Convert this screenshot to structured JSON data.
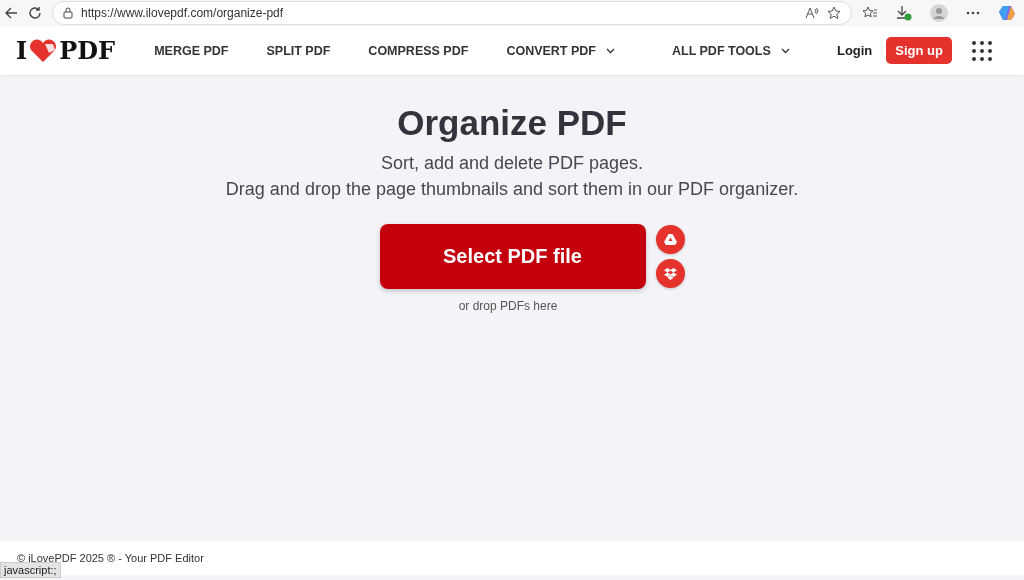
{
  "browser": {
    "url": "https://www.ilovepdf.com/organize-pdf",
    "status_tooltip": "javascript:;"
  },
  "header": {
    "logo_left": "I",
    "logo_right": "PDF",
    "nav": [
      {
        "label": "MERGE PDF",
        "dropdown": false
      },
      {
        "label": "SPLIT PDF",
        "dropdown": false
      },
      {
        "label": "COMPRESS PDF",
        "dropdown": false
      },
      {
        "label": "CONVERT PDF",
        "dropdown": true
      },
      {
        "label": "ALL PDF TOOLS",
        "dropdown": true
      }
    ],
    "login": "Login",
    "signup": "Sign up"
  },
  "main": {
    "title": "Organize PDF",
    "subtitle_lines": [
      "Sort, add and delete PDF pages.",
      "Drag and drop the page thumbnails and sort them in our PDF organizer."
    ],
    "select_button": "Select PDF file",
    "drop_hint": "or drop PDFs here"
  },
  "footer": {
    "text": "© iLovePDF 2025 ® - Your PDF Editor"
  }
}
